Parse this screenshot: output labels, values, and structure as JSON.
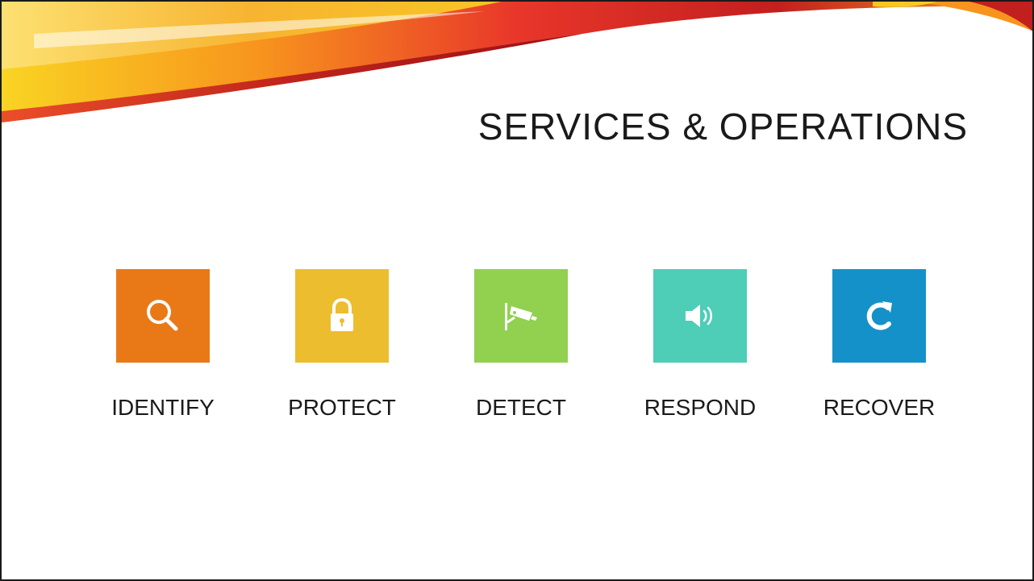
{
  "slide": {
    "title": "SERVICES & OPERATIONS"
  },
  "functions": [
    {
      "label": "IDENTIFY",
      "icon": "search-icon",
      "color": "#e97917"
    },
    {
      "label": "PROTECT",
      "icon": "lock-icon",
      "color": "#ecbd2f"
    },
    {
      "label": "DETECT",
      "icon": "security-camera-icon",
      "color": "#92d050"
    },
    {
      "label": "RESPOND",
      "icon": "speaker-icon",
      "color": "#4ecdb7"
    },
    {
      "label": "RECOVER",
      "icon": "refresh-icon",
      "color": "#1591c9"
    }
  ],
  "theme": {
    "swoosh_colors": [
      "#f9d423",
      "#f7941d",
      "#e8362a",
      "#b5121b"
    ],
    "text_color": "#1a1a1a"
  }
}
